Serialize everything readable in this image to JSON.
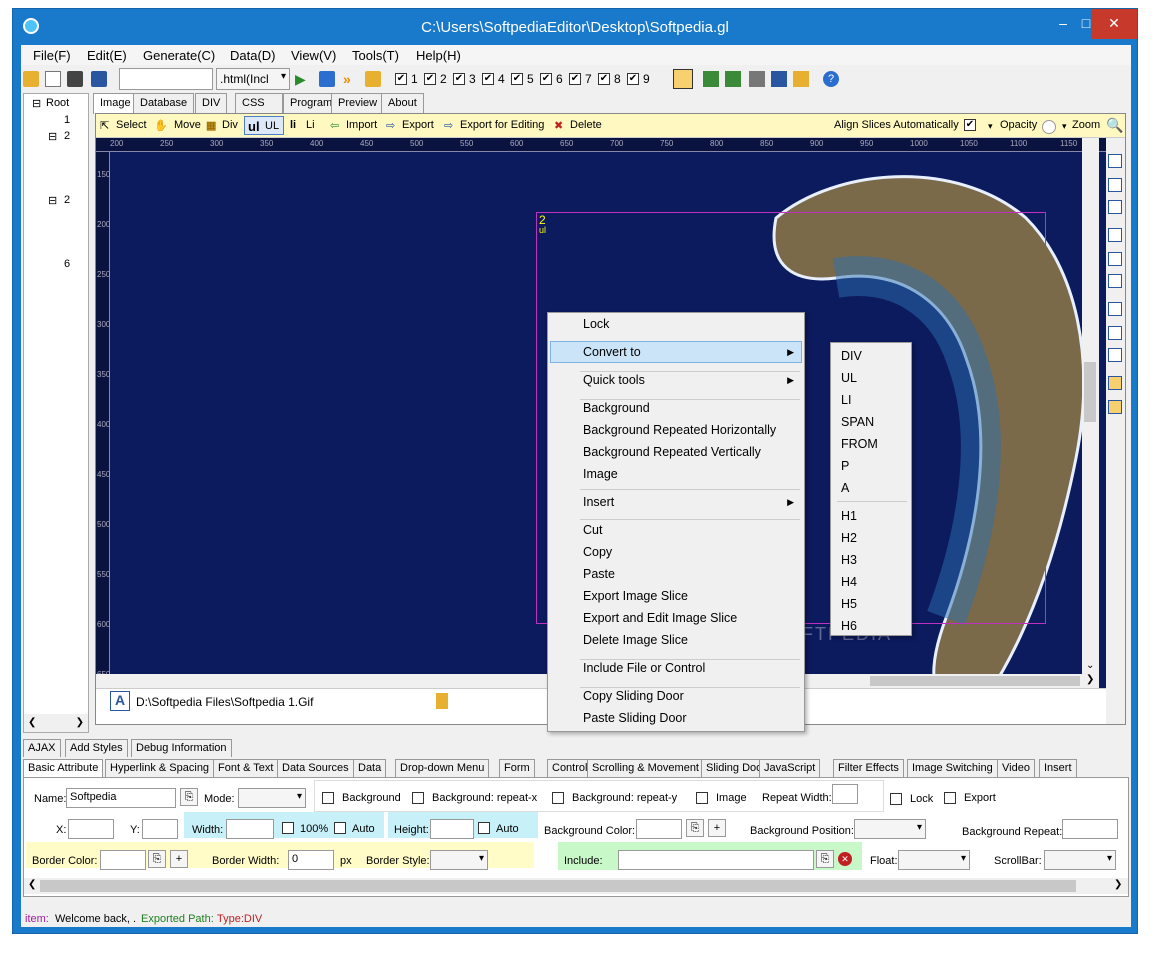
{
  "window": {
    "title": "C:\\Users\\SoftpediaEditor\\Desktop\\Softpedia.gl",
    "minimize": "–",
    "maximize": "□",
    "close": "✕"
  },
  "menu": [
    "File(F)",
    "Edit(E)",
    "Generate(C)",
    "Data(D)",
    "View(V)",
    "Tools(T)",
    "Help(H)"
  ],
  "toolbar": {
    "format_select": ".html(Incl",
    "checks": [
      "1",
      "2",
      "3",
      "4",
      "5",
      "6",
      "7",
      "8",
      "9"
    ]
  },
  "tree": {
    "root": "Root",
    "items": [
      "1",
      "2",
      "2",
      "6"
    ]
  },
  "tabs": [
    "Image",
    "Database",
    "DIV",
    "CSS",
    "Program",
    "Preview",
    "About"
  ],
  "image_tools": {
    "select": "Select",
    "move": "Move",
    "div": "Div",
    "ul": "UL",
    "li": "Li",
    "import": "Import",
    "export": "Export",
    "export_edit": "Export for Editing",
    "delete": "Delete",
    "align": "Align Slices Automatically",
    "opacity": "Opacity",
    "zoom": "Zoom"
  },
  "ruler": {
    "h": [
      "200",
      "250",
      "300",
      "350",
      "400",
      "450",
      "500",
      "550",
      "600",
      "650",
      "700",
      "750",
      "800",
      "850",
      "900",
      "950",
      "1000",
      "1050",
      "1100",
      "1150"
    ],
    "v": [
      "150",
      "200",
      "250",
      "300",
      "350",
      "400",
      "450",
      "500",
      "550",
      "600",
      "650"
    ]
  },
  "slice": {
    "number": "2",
    "tag": "ul"
  },
  "watermark": "SOFTPEDIA",
  "path": "D:\\Softpedia Files\\Softpedia 1.Gif",
  "context_menu": {
    "items": [
      "Lock",
      "Convert to",
      "Quick tools",
      "Background",
      "Background Repeated Horizontally",
      "Background Repeated Vertically",
      "Image",
      "Insert",
      "Cut",
      "Copy",
      "Paste",
      "Export Image Slice",
      "Export and Edit Image Slice",
      "Delete Image Slice",
      "Include File or Control",
      "Copy Sliding Door",
      "Paste Sliding Door"
    ]
  },
  "submenu": {
    "items": [
      "DIV",
      "UL",
      "LI",
      "SPAN",
      "FROM",
      "P",
      "A",
      "H1",
      "H2",
      "H3",
      "H4",
      "H5",
      "H6"
    ]
  },
  "bottom_tabs_row1": [
    "AJAX",
    "Add Styles",
    "Debug Information"
  ],
  "bottom_tabs_row2": [
    "Basic Attribute",
    "Hyperlink & Spacing",
    "Font & Text",
    "Data Sources",
    "Data",
    "Drop-down Menu",
    "Form",
    "Controls",
    "Scrolling & Movement",
    "Sliding Door",
    "JavaScript",
    "Filter Effects",
    "Image Switching",
    "Video",
    "Insert"
  ],
  "props": {
    "name_label": "Name:",
    "name_value": "Softpedia",
    "mode_label": "Mode:",
    "background": "Background",
    "bg_repeat_x": "Background: repeat-x",
    "bg_repeat_y": "Background: repeat-y",
    "image": "Image",
    "repeat_width": "Repeat Width:",
    "lock": "Lock",
    "export": "Export",
    "x_label": "X:",
    "y_label": "Y:",
    "width_label": "Width:",
    "pct": "100%",
    "auto": "Auto",
    "height_label": "Height:",
    "bg_color": "Background Color:",
    "bg_position": "Background Position:",
    "bg_repeat": "Background Repeat:",
    "border_color": "Border Color:",
    "border_width": "Border Width:",
    "border_width_value": "0",
    "px": "px",
    "border_style": "Border Style:",
    "include": "Include:",
    "float": "Float:",
    "scrollbar": "ScrollBar:"
  },
  "status": {
    "item": "item:",
    "welcome": "Welcome back, .",
    "exported": "Exported Path:",
    "type": "Type:DIV"
  }
}
